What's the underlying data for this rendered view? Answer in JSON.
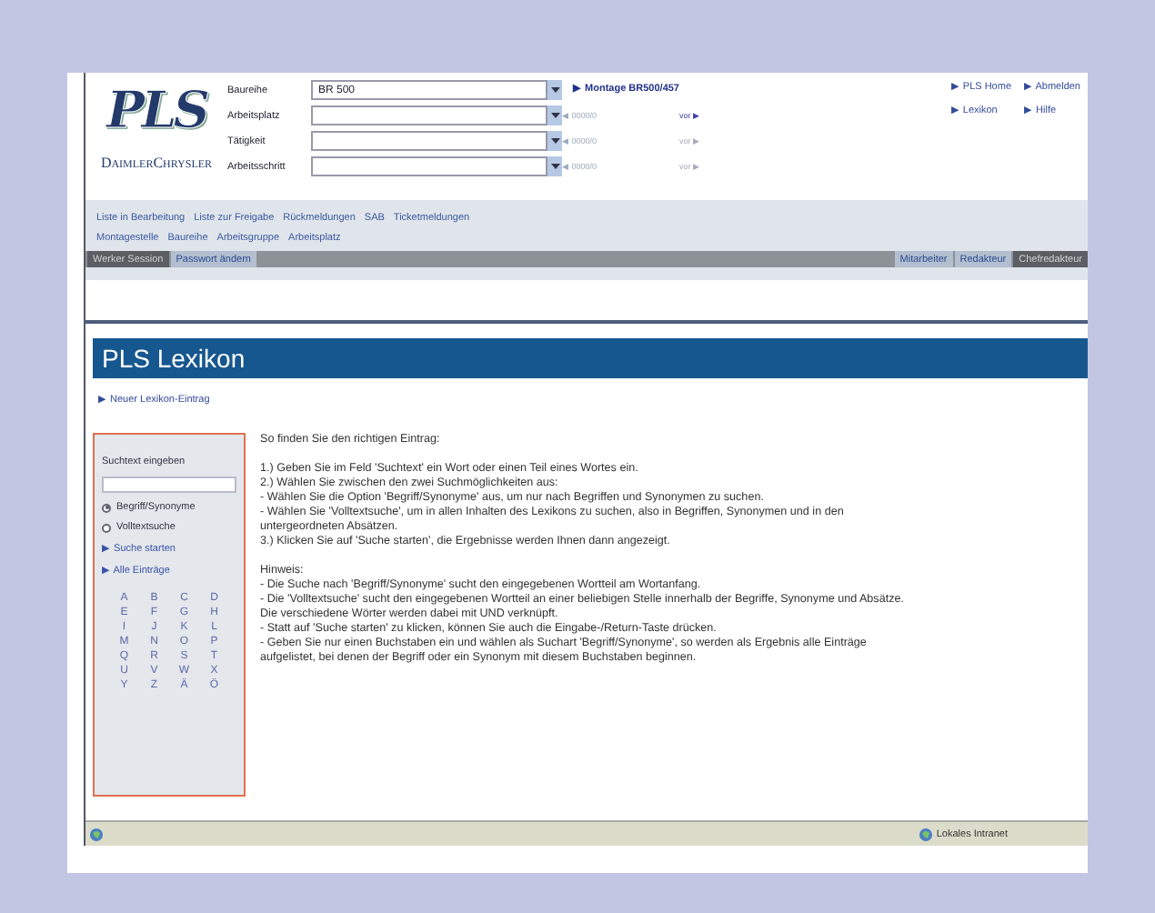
{
  "header": {
    "logo": "PLS",
    "company": "DaimlerChrysler",
    "fields": [
      {
        "label": "Baureihe",
        "value": "BR 500"
      },
      {
        "label": "Arbeitsplatz",
        "pager": {
          "prev": "◀ 0000/0",
          "next": "vor ▶",
          "disabled": false
        }
      },
      {
        "label": "Tätigkeit",
        "pager": {
          "prev": "◀ 0000/0",
          "next": "vor ▶",
          "disabled": true
        }
      },
      {
        "label": "Arbeitsschritt",
        "pager": {
          "prev": "◀ 0000/0",
          "next": "vor ▶",
          "disabled": true
        }
      }
    ],
    "montage_link": "▶ Montage BR500/457",
    "links": [
      "▶ PLS Home",
      "▶ Abmelden",
      "▶ Lexikon",
      "▶ Hilfe"
    ]
  },
  "nav_rows": [
    [
      "Liste in Bearbeitung",
      "Liste zur Freigabe",
      "Rückmeldungen",
      "SAB",
      "Ticketmeldungen"
    ],
    [
      "Montagestelle",
      "Baureihe",
      "Arbeitsgruppe",
      "Arbeitsplatz"
    ]
  ],
  "session_tabs": [
    {
      "label": "Werker Session",
      "selected": true
    },
    {
      "label": "Passwort ändern",
      "selected": false
    }
  ],
  "role_tabs": [
    {
      "label": "Mitarbeiter",
      "selected": false
    },
    {
      "label": "Redakteur",
      "selected": false
    },
    {
      "label": "Chefredakteur",
      "selected": true
    }
  ],
  "lexikon": {
    "title": "PLS Lexikon",
    "new_link": "▶ Neuer Lexikon-Eintrag",
    "search_label": "Suchtext eingeben",
    "options": [
      {
        "label": "Begriff/Synonyme",
        "selected": true
      },
      {
        "label": "Volltextsuche",
        "selected": false
      }
    ],
    "links": [
      "▶ Suche starten",
      "▶ Alle Einträge"
    ],
    "letters": [
      "A",
      "B",
      "C",
      "D",
      "E",
      "F",
      "G",
      "H",
      "I",
      "J",
      "K",
      "L",
      "M",
      "N",
      "O",
      "P",
      "Q",
      "R",
      "S",
      "T",
      "U",
      "V",
      "W",
      "X",
      "Y",
      "Z",
      "Ä",
      "Ö"
    ],
    "intro": "So finden Sie den richtigen Eintrag:",
    "steps": [
      "1.) Geben Sie im Feld 'Suchtext' ein Wort oder einen Teil eines Wortes ein.",
      "2.) Wählen Sie zwischen den zwei Suchmöglichkeiten aus:",
      "- Wählen Sie die Option 'Begriff/Synonyme' aus, um nur nach Begriffen und Synonymen zu suchen.",
      "- Wählen Sie 'Volltextsuche', um in allen Inhalten des Lexikons zu suchen, also in Begriffen, Synonymen und in den untergeordneten Absätzen.",
      "3.) Klicken Sie auf 'Suche starten', die Ergebnisse werden Ihnen dann angezeigt."
    ],
    "note_title": "Hinweis:",
    "notes": [
      "- Die Suche nach 'Begriff/Synonyme' sucht den eingegebenen Wortteil am Wortanfang.",
      "- Die 'Volltextsuche' sucht den eingegebenen Wortteil an einer beliebigen Stelle innerhalb der Begriffe, Synonyme und Absätze. Die verschiedene Wörter werden dabei mit UND verknüpft.",
      "- Statt auf 'Suche starten' zu klicken, können Sie auch die Eingabe-/Return-Taste drücken.",
      "- Geben Sie nur einen Buchstaben ein und wählen als Suchart 'Begriff/Synonyme', so werden als Ergebnis alle Einträge aufgelistet, bei denen der Begriff oder ein Synonym mit diesem Buchstaben beginnen."
    ]
  },
  "status_bar": {
    "zone": "Lokales Intranet"
  }
}
